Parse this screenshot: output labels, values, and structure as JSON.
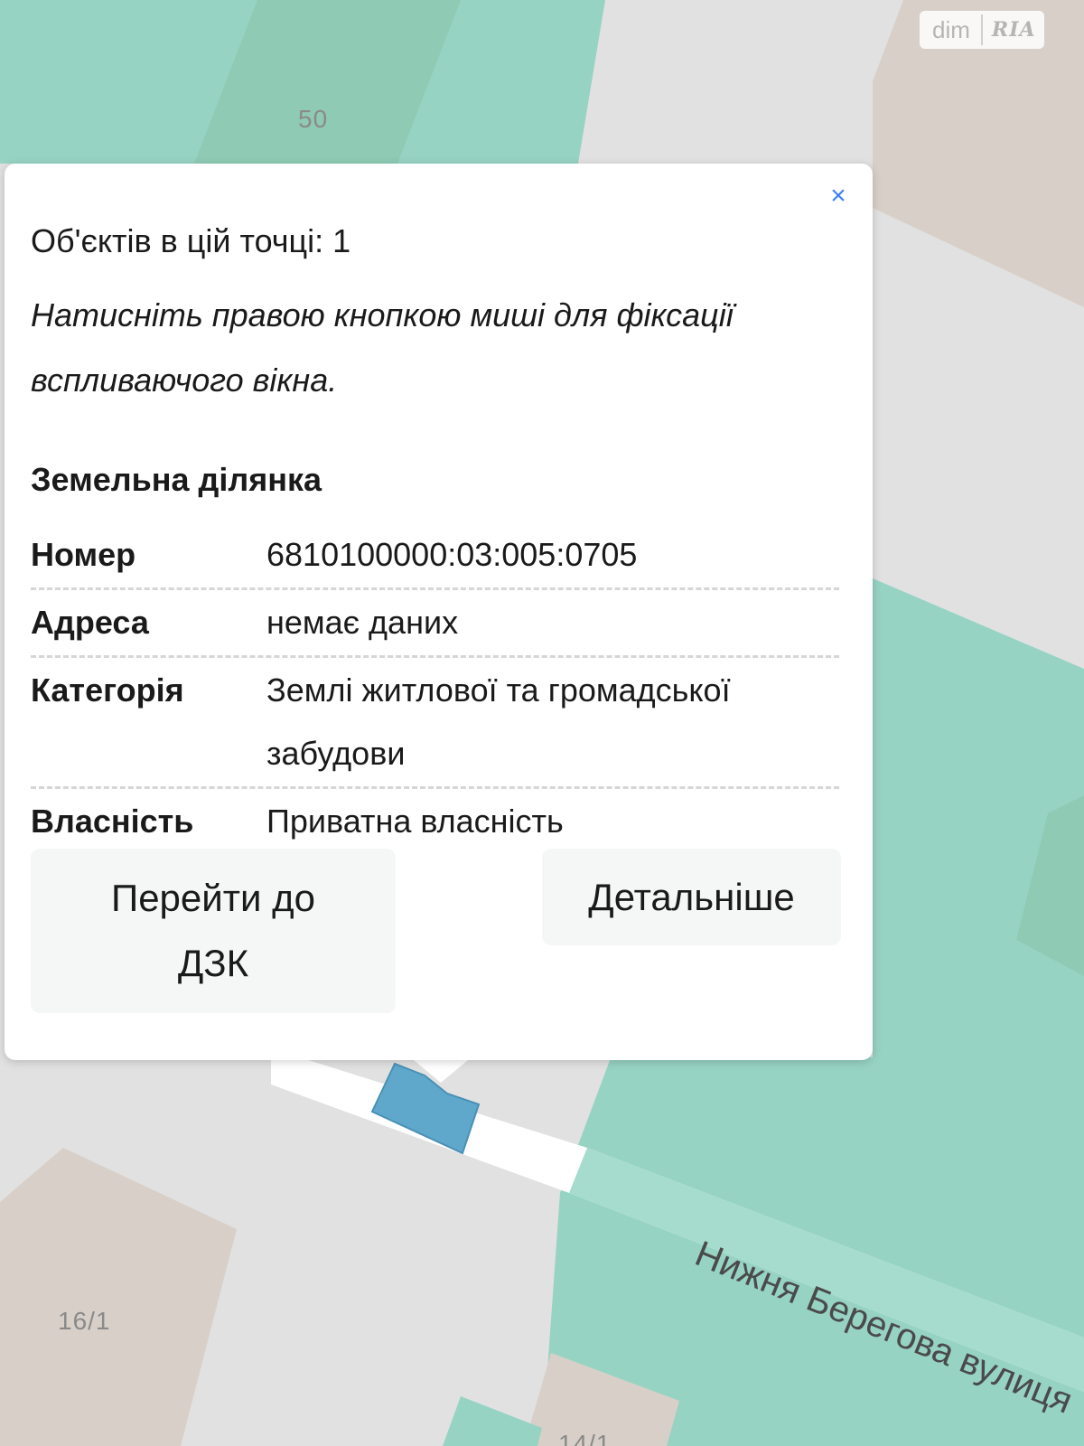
{
  "map": {
    "colors": {
      "background": "#e1e1e1",
      "green_parcel": "#97d3c3",
      "green_parcel_dark": "#8fcab5",
      "beige_parcel": "#d8d0c8",
      "blue_selected": "#5fa8cc",
      "road": "#ffffff"
    },
    "parcel_labels": [
      "50",
      "16/1",
      "14/1"
    ],
    "street_label": "Нижня Берегова вулиця"
  },
  "brand": {
    "dim": "dim",
    "ria": "RIA"
  },
  "popup": {
    "close_symbol": "×",
    "objects_count": "Об'єктів в цій точці: 1",
    "hint": "Натисніть правою кнопкою миші для фіксації вспливаючого вікна.",
    "section_title": "Земельна ділянка",
    "rows": [
      {
        "key": "Номер",
        "value": "6810100000:03:005:0705"
      },
      {
        "key": "Адреса",
        "value": "немає даних"
      },
      {
        "key": "Категорія",
        "value": "Землі житлової та громадської забудови"
      },
      {
        "key": "Власність",
        "value": "Приватна власність"
      }
    ],
    "buttons": {
      "go_dzk": "Перейти до ДЗК",
      "details": "Детальніше"
    },
    "accent_color": "#3b82f6"
  }
}
